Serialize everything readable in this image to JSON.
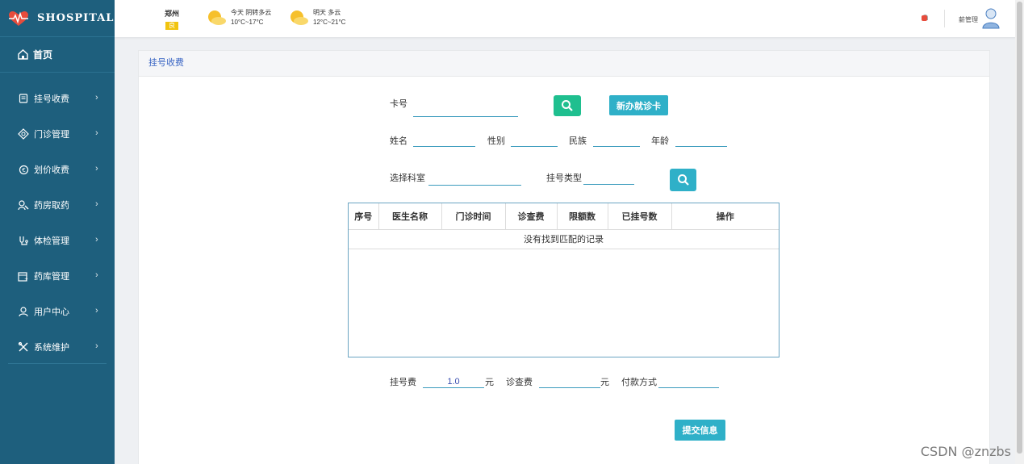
{
  "app": {
    "brand": "SHOSPITAL"
  },
  "sidebar": {
    "home": {
      "label": "首页",
      "icon": "home-icon"
    },
    "items": [
      {
        "label": "挂号收费",
        "icon": "card-icon"
      },
      {
        "label": "门诊管理",
        "icon": "stethoscope-icon"
      },
      {
        "label": "划价收费",
        "icon": "pricing-icon"
      },
      {
        "label": "药房取药",
        "icon": "pill-icon"
      },
      {
        "label": "体检管理",
        "icon": "checkup-icon"
      },
      {
        "label": "药库管理",
        "icon": "warehouse-icon"
      },
      {
        "label": "用户中心",
        "icon": "user-icon"
      },
      {
        "label": "系统维护",
        "icon": "tools-icon"
      }
    ]
  },
  "topbar": {
    "city": "郑州",
    "city_badge": "良",
    "today": {
      "label": "今天",
      "condition": "阴转多云",
      "temp": "10°C~17°C"
    },
    "tomorrow": {
      "label": "明天",
      "condition": "多云",
      "temp": "12°C~21°C"
    },
    "user": "薪管理"
  },
  "panel": {
    "title": "挂号收费"
  },
  "form": {
    "card_label": "卡号",
    "card_value": "",
    "new_card_button": "新办就诊卡",
    "name_label": "姓名",
    "gender_label": "性别",
    "ethnicity_label": "民族",
    "age_label": "年龄",
    "dept_label": "选择科室",
    "reg_type_label": "挂号类型"
  },
  "table": {
    "headers": [
      "序号",
      "医生名称",
      "门诊时间",
      "诊查费",
      "限额数",
      "已挂号数",
      "操作"
    ],
    "empty_text": "没有找到匹配的记录"
  },
  "fees": {
    "reg_fee_label": "挂号费",
    "reg_fee_value": "1.0",
    "yuan1": "元",
    "exam_fee_label": "诊查费",
    "exam_fee_value": "",
    "yuan2": "元",
    "pay_method_label": "付款方式",
    "pay_method_value": ""
  },
  "submit_button": "提交信息",
  "watermark": "CSDN @znzbs",
  "colors": {
    "sidebar": "#1e5f7d",
    "accent_teal": "#2fb0c8",
    "accent_green": "#1fbf8f",
    "link_blue": "#3a66c4"
  }
}
